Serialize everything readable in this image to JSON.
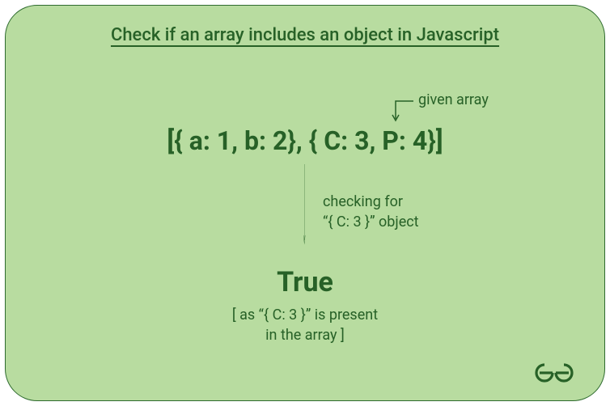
{
  "title": "Check if an array includes an object in Javascript",
  "labels": {
    "given_array": "given array",
    "checking_line1": "checking for",
    "checking_line2": "“{ C: 3 }” object"
  },
  "array_literal": "[{ a: 1, b: 2}, { C: 3, P: 4}]",
  "result": "True",
  "explain_line1": "[ as “{ C: 3 }” is present",
  "explain_line2": "in the array ]",
  "colors": {
    "bg": "#b8dca0",
    "text": "#276127",
    "border": "#2f6b2f"
  }
}
